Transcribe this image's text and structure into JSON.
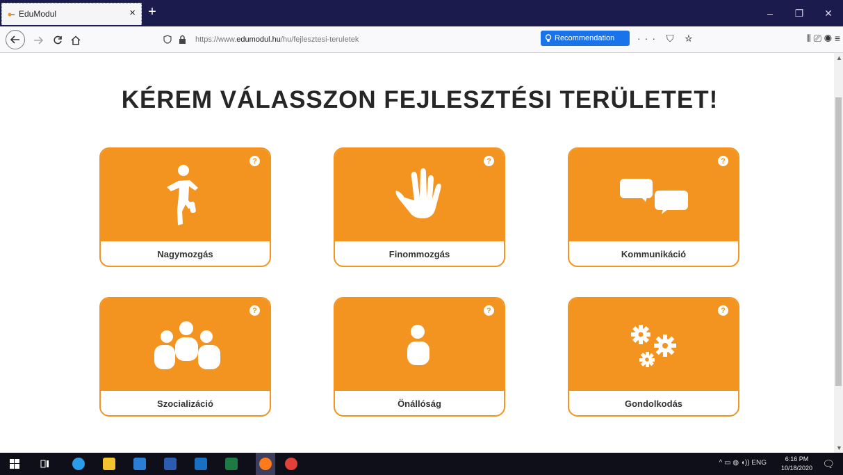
{
  "browser": {
    "tab_title": "EduModul",
    "tab_close": "×",
    "new_tab": "+",
    "window_controls": [
      "–",
      "❐",
      "✕"
    ],
    "url_prefix": "https://www.",
    "url_domain": "edumodul.hu",
    "url_path": "/hu/fejlesztesi-teruletek",
    "recommendation_label": "Recommendation",
    "nav_icons": [
      "back-icon",
      "forward-icon",
      "reload-icon",
      "home-icon"
    ],
    "url_icons": "··· ⛉ ☆",
    "toolbar_icons": "⫴ ⎚ ◉ ≡"
  },
  "page": {
    "headline": "KÉREM VÁLASSZON FEJLESZTÉSI TERÜLETET!",
    "help_symbol": "?",
    "cards": [
      {
        "label": "Nagymozgás",
        "icon": "running-person-icon"
      },
      {
        "label": "Finommozgás",
        "icon": "hand-icon"
      },
      {
        "label": "Kommunikáció",
        "icon": "chat-bubbles-icon"
      },
      {
        "label": "Szocializáció",
        "icon": "group-icon"
      },
      {
        "label": "Önállóság",
        "icon": "person-icon"
      },
      {
        "label": "Gondolkodás",
        "icon": "gears-icon"
      }
    ],
    "accent_color": "#f39420"
  },
  "taskbar": {
    "language": "ENG",
    "time": "6:16 PM",
    "date": "10/18/2020"
  }
}
